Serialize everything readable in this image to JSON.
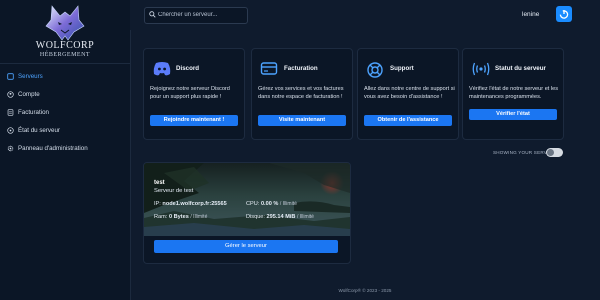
{
  "brand": {
    "name": "WOLFCORP",
    "subtitle": "HÉBERGEMENT"
  },
  "sidebar": {
    "items": [
      {
        "label": "Serveurs",
        "icon": "server-icon",
        "active": true
      },
      {
        "label": "Compte",
        "icon": "user-icon"
      },
      {
        "label": "Facturation",
        "icon": "billing-icon"
      },
      {
        "label": "État du serveur",
        "icon": "status-icon"
      },
      {
        "label": "Panneau d'administration",
        "icon": "gear-icon"
      }
    ]
  },
  "topbar": {
    "search_placeholder": "Chercher un serveur...",
    "username": "lenine"
  },
  "cards": [
    {
      "title": "Discord",
      "icon": "discord-icon",
      "text": "Rejoignez notre serveur Discord pour un support plus rapide !",
      "button": "Rejoindre maintenant !"
    },
    {
      "title": "Facturation",
      "icon": "credit-card-icon",
      "text": "Gérez vos services et vos factures dans notre espace de facturation !",
      "button": "Visite maintenant"
    },
    {
      "title": "Support",
      "icon": "lifebuoy-icon",
      "text": "Allez dans notre centre de support si vous avez besoin d'assistance !",
      "button": "Obtenir de l'assistance"
    },
    {
      "title": "Statut du serveur",
      "icon": "signal-icon",
      "text": "Vérifiez l'état de notre serveur et les maintenances programmées.",
      "button": "Vérifier l'état"
    }
  ],
  "toggle": {
    "label": "SHOWING YOUR SERVERS",
    "on": false
  },
  "server": {
    "name": "test",
    "description": "Serveur de test",
    "ip_label": "IP:",
    "ip": "node1.wolfcorp.fr:25565",
    "cpu_label": "CPU:",
    "cpu": "0.00 %",
    "cpu_limit": "/ Illimité",
    "ram_label": "Ram:",
    "ram": "0 Bytes",
    "ram_limit": "/ Illimité",
    "disk_label": "Disque:",
    "disk": "295.14 MiB",
    "disk_limit": "/ Illimité",
    "button": "Gérer le serveur"
  },
  "footer": "WolfCorp® © 2023 - 2025",
  "colors": {
    "accent": "#1b76f2",
    "background": "#0f1b2d",
    "sidebar": "#0b1626"
  }
}
